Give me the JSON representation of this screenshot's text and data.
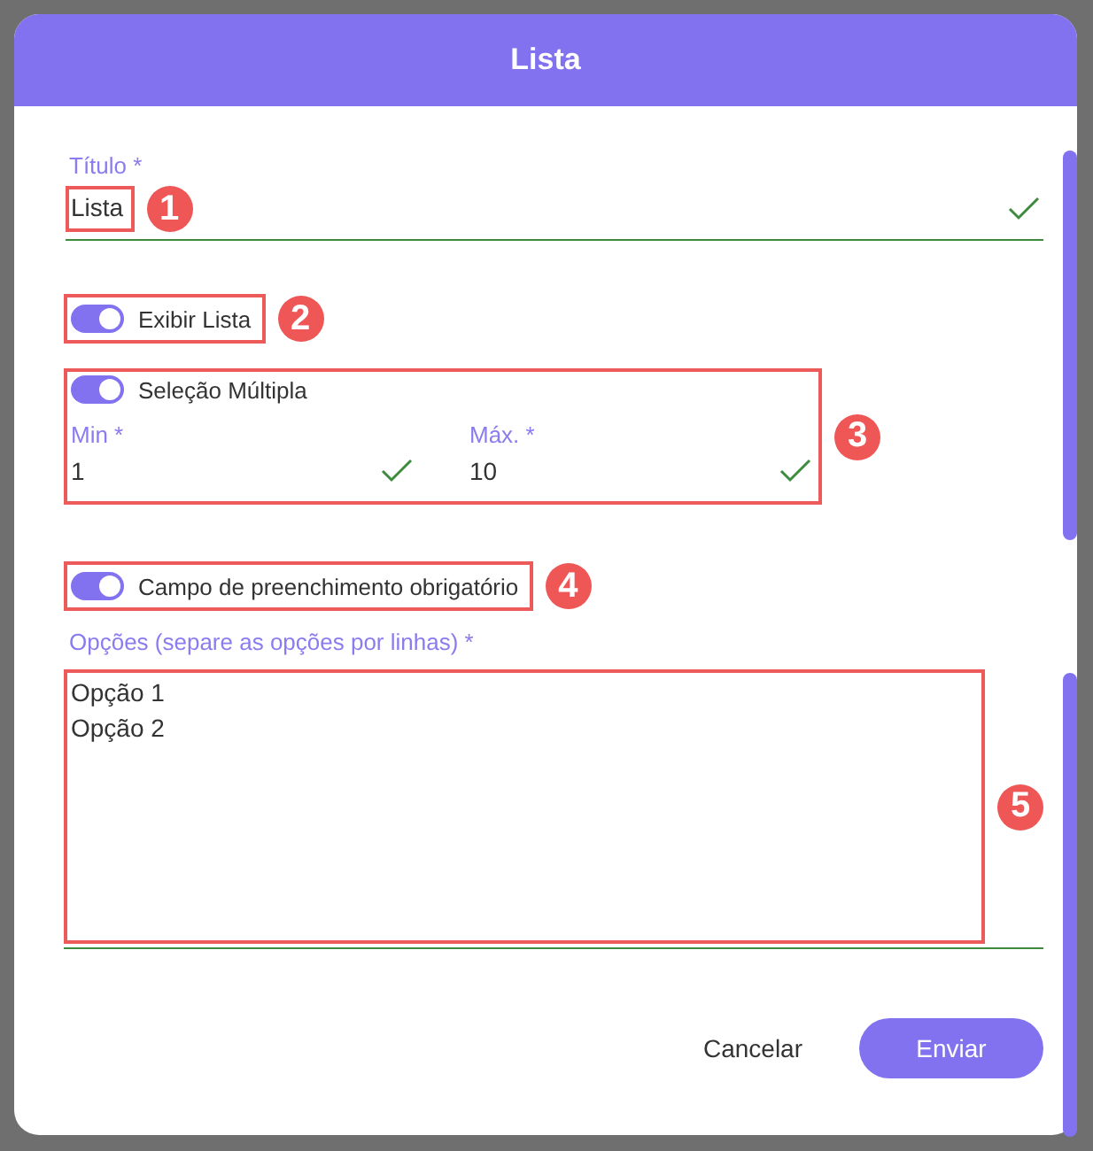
{
  "dialog": {
    "title": "Lista"
  },
  "title_field": {
    "label": "Título *",
    "value": "Lista",
    "valid": true,
    "callout": "1"
  },
  "show_toggle": {
    "label": "Exibir Lista",
    "on": true,
    "callout": "2"
  },
  "multiple": {
    "callout": "3",
    "toggle": {
      "label": "Seleção Múltipla",
      "on": true
    },
    "fields": [
      {
        "label": "Min *",
        "value": "1",
        "valid": true
      },
      {
        "label": "Máx. *",
        "value": "10",
        "valid": true
      }
    ]
  },
  "required_toggle": {
    "label": "Campo de preenchimento obrigatório",
    "on": true,
    "callout": "4"
  },
  "options_field": {
    "label": "Opções (separe as opções por linhas) *",
    "lines": [
      "Opção 1",
      "Opção 2"
    ],
    "valid": true,
    "callout": "5"
  },
  "buttons": [
    {
      "label": "Cancelar",
      "kind": "text"
    },
    {
      "label": "Enviar",
      "kind": "primary"
    }
  ]
}
